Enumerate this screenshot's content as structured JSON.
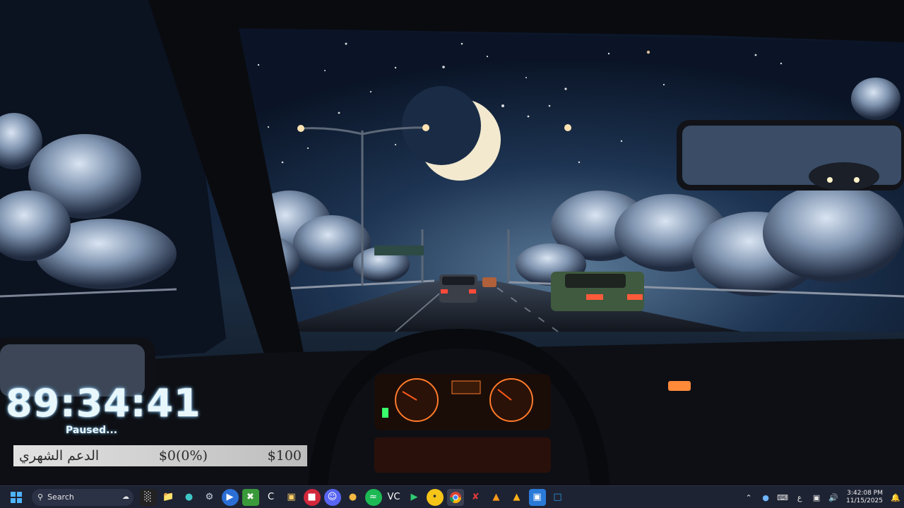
{
  "overlay": {
    "timer": "89:34:41",
    "status": "Paused...",
    "donation": {
      "label": "الدعم الشهري",
      "current": "$0(0%)",
      "goal": "$100",
      "progress_fraction": 0
    }
  },
  "taskbar": {
    "search_placeholder": "Search",
    "icons": [
      "start-icon",
      "search-icon",
      "terminal-icon",
      "file-explorer-icon",
      "edge-icon",
      "steam-icon",
      "app-icon",
      "xbox-icon",
      "c-app-icon",
      "store-icon",
      "app-red-icon",
      "discord-icon",
      "app-face-icon",
      "spotify-icon",
      "vc-icon",
      "app-green-icon",
      "app-yellow-icon",
      "chrome-icon",
      "app-x-icon",
      "app-orange-icon",
      "app-orange-2-icon",
      "app-blue-icon",
      "app-blue-2-icon"
    ],
    "tray": {
      "language": "ع",
      "time": "3:42:08 PM",
      "date": "11/15/2025"
    }
  },
  "colors": {
    "timer": "#e8f7fb",
    "taskbar": "#1e2333",
    "donation_bar": "#d0d0d0"
  }
}
